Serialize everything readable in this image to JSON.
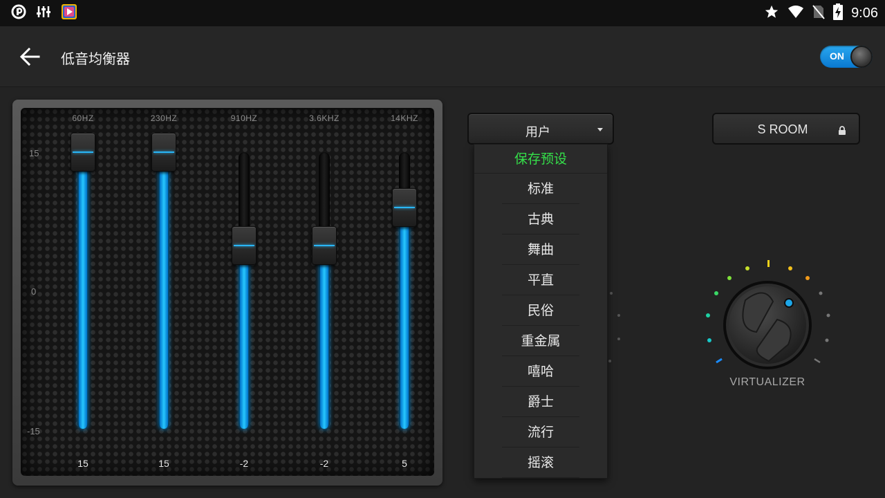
{
  "status_bar": {
    "time": "9:06",
    "left_icons": [
      "app-notification-icon",
      "equalizer-icon",
      "media-app-icon"
    ],
    "right_icons": [
      "star-icon",
      "wifi-icon",
      "no-sim-icon",
      "battery-charging-icon"
    ]
  },
  "app_bar": {
    "title": "低音均衡器",
    "toggle_label": "ON",
    "toggle_state": true
  },
  "equalizer": {
    "scale": {
      "top": "15",
      "middle": "0",
      "bottom": "-15"
    },
    "bands": [
      {
        "freq": "60HZ",
        "value": "15",
        "level": 15
      },
      {
        "freq": "230HZ",
        "value": "15",
        "level": 15
      },
      {
        "freq": "910HZ",
        "value": "-2",
        "level": -2
      },
      {
        "freq": "3.6KHZ",
        "value": "-2",
        "level": -2
      },
      {
        "freq": "14KHZ",
        "value": "5",
        "level": 5
      }
    ],
    "accent_color": "#27c8ff"
  },
  "preset": {
    "selected": "用户",
    "options": [
      "保存预设",
      "标准",
      "古典",
      "舞曲",
      "平直",
      "民俗",
      "重金属",
      "嘻哈",
      "爵士",
      "流行",
      "摇滚"
    ],
    "save_color": "#35e04a"
  },
  "room": {
    "label": "S ROOM",
    "locked": true
  },
  "virtualizer": {
    "label": "VIRTUALIZER"
  }
}
